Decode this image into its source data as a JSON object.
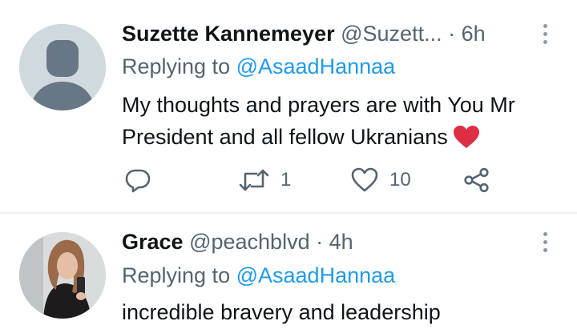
{
  "tweets": [
    {
      "name": "Suzette Kannemeyer",
      "handle": "@Suzett...",
      "dot": "·",
      "time": "6h",
      "replying_label": "Replying to",
      "replying_to": "@AsaadHannaa",
      "text": "My thoughts and prayers are with You Mr President and all fellow Ukranians",
      "emoji": "red-heart-emoji",
      "actions": {
        "reply_icon": "reply-icon",
        "retweet_icon": "retweet-icon",
        "retweet_count": "1",
        "like_icon": "like-icon",
        "like_count": "10",
        "share_icon": "share-icon"
      }
    },
    {
      "name": "Grace",
      "handle": "@peachblvd",
      "dot": "·",
      "time": "4h",
      "replying_label": "Replying to",
      "replying_to": "@AsaadHannaa",
      "text": "incredible bravery and leadership"
    }
  ],
  "colors": {
    "text": "#0f1419",
    "secondary": "#536471",
    "link": "#1d9bf0",
    "divider": "#eff3f4",
    "avatar_placeholder": "#cfd9de",
    "heart": "#e0245e"
  }
}
